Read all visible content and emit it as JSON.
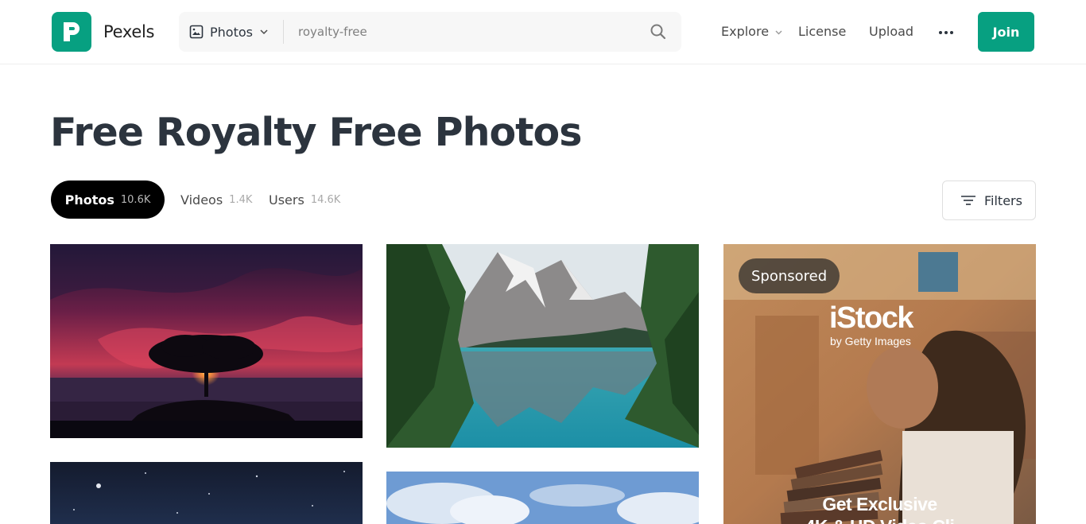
{
  "header": {
    "brand": "Pexels",
    "search": {
      "type_label": "Photos",
      "query": "royalty-free"
    },
    "nav": {
      "explore": "Explore",
      "license": "License",
      "upload": "Upload"
    },
    "join_label": "Join"
  },
  "page": {
    "title": "Free Royalty Free Photos"
  },
  "tabs": [
    {
      "label": "Photos",
      "count": "10.6K"
    },
    {
      "label": "Videos",
      "count": "1.4K"
    },
    {
      "label": "Users",
      "count": "14.6K"
    }
  ],
  "filters_label": "Filters",
  "ad": {
    "badge": "Sponsored",
    "brand": "iStock",
    "tagline": "by Getty Images",
    "cta_line1": "Get Exclusive",
    "cta_line2": "4K & HD Video Cli"
  },
  "colors": {
    "accent": "#07a081",
    "text": "#2c343e",
    "tab_active_bg": "#000000"
  },
  "icons": [
    "pexels-logo-icon",
    "image-icon",
    "chevron-down-icon",
    "search-icon",
    "more-dots-icon",
    "filter-icon"
  ]
}
